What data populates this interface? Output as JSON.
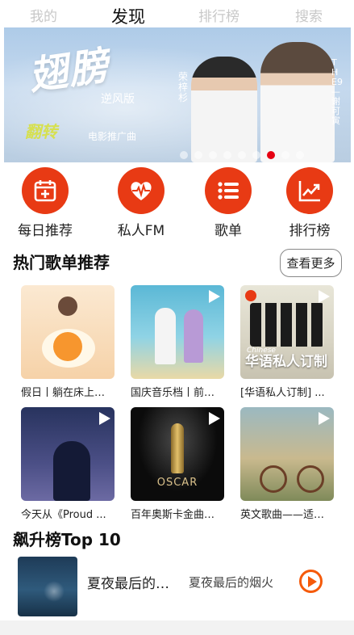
{
  "tabs": [
    {
      "label": "我的",
      "active": false
    },
    {
      "label": "发现",
      "active": true
    },
    {
      "label": "排行榜",
      "active": false
    },
    {
      "label": "搜索",
      "active": false
    }
  ],
  "banner": {
    "title": "翅膀",
    "subtitle": "逆风版",
    "signature": "翻转",
    "promo": "电影推广曲",
    "artist_left": "荣梓杉",
    "artist_right": "THE9—谢可寅",
    "dots_total": 9,
    "active_dot": 6
  },
  "quick_nav": [
    {
      "label": "每日推荐",
      "icon": "calendar-icon"
    },
    {
      "label": "私人FM",
      "icon": "heartbeat-icon"
    },
    {
      "label": "歌单",
      "icon": "list-icon"
    },
    {
      "label": "排行榜",
      "icon": "trend-chart-icon"
    }
  ],
  "hot": {
    "title": "热门歌单推荐",
    "more_label": "查看更多",
    "playlists": [
      {
        "title": "假日丨躺在床上…"
      },
      {
        "title": "国庆音乐档丨前…"
      },
      {
        "title": "[华语私人订制] ...",
        "cover_caption": "华语私人订制",
        "cover_tag": "Chinese"
      },
      {
        "title": "今天从《Proud ..."
      },
      {
        "title": "百年奥斯卡金曲…",
        "cover_caption": "OSCAR"
      },
      {
        "title": "英文歌曲——适…"
      }
    ]
  },
  "top10": {
    "title": "飙升榜Top 10",
    "songs": [
      {
        "name": "夏夜最后的烟火",
        "sub": "夏夜最后的烟火"
      }
    ]
  },
  "colors": {
    "accent": "#e83a14",
    "play_orange": "#f55a0a",
    "active_dot": "#e60012"
  }
}
